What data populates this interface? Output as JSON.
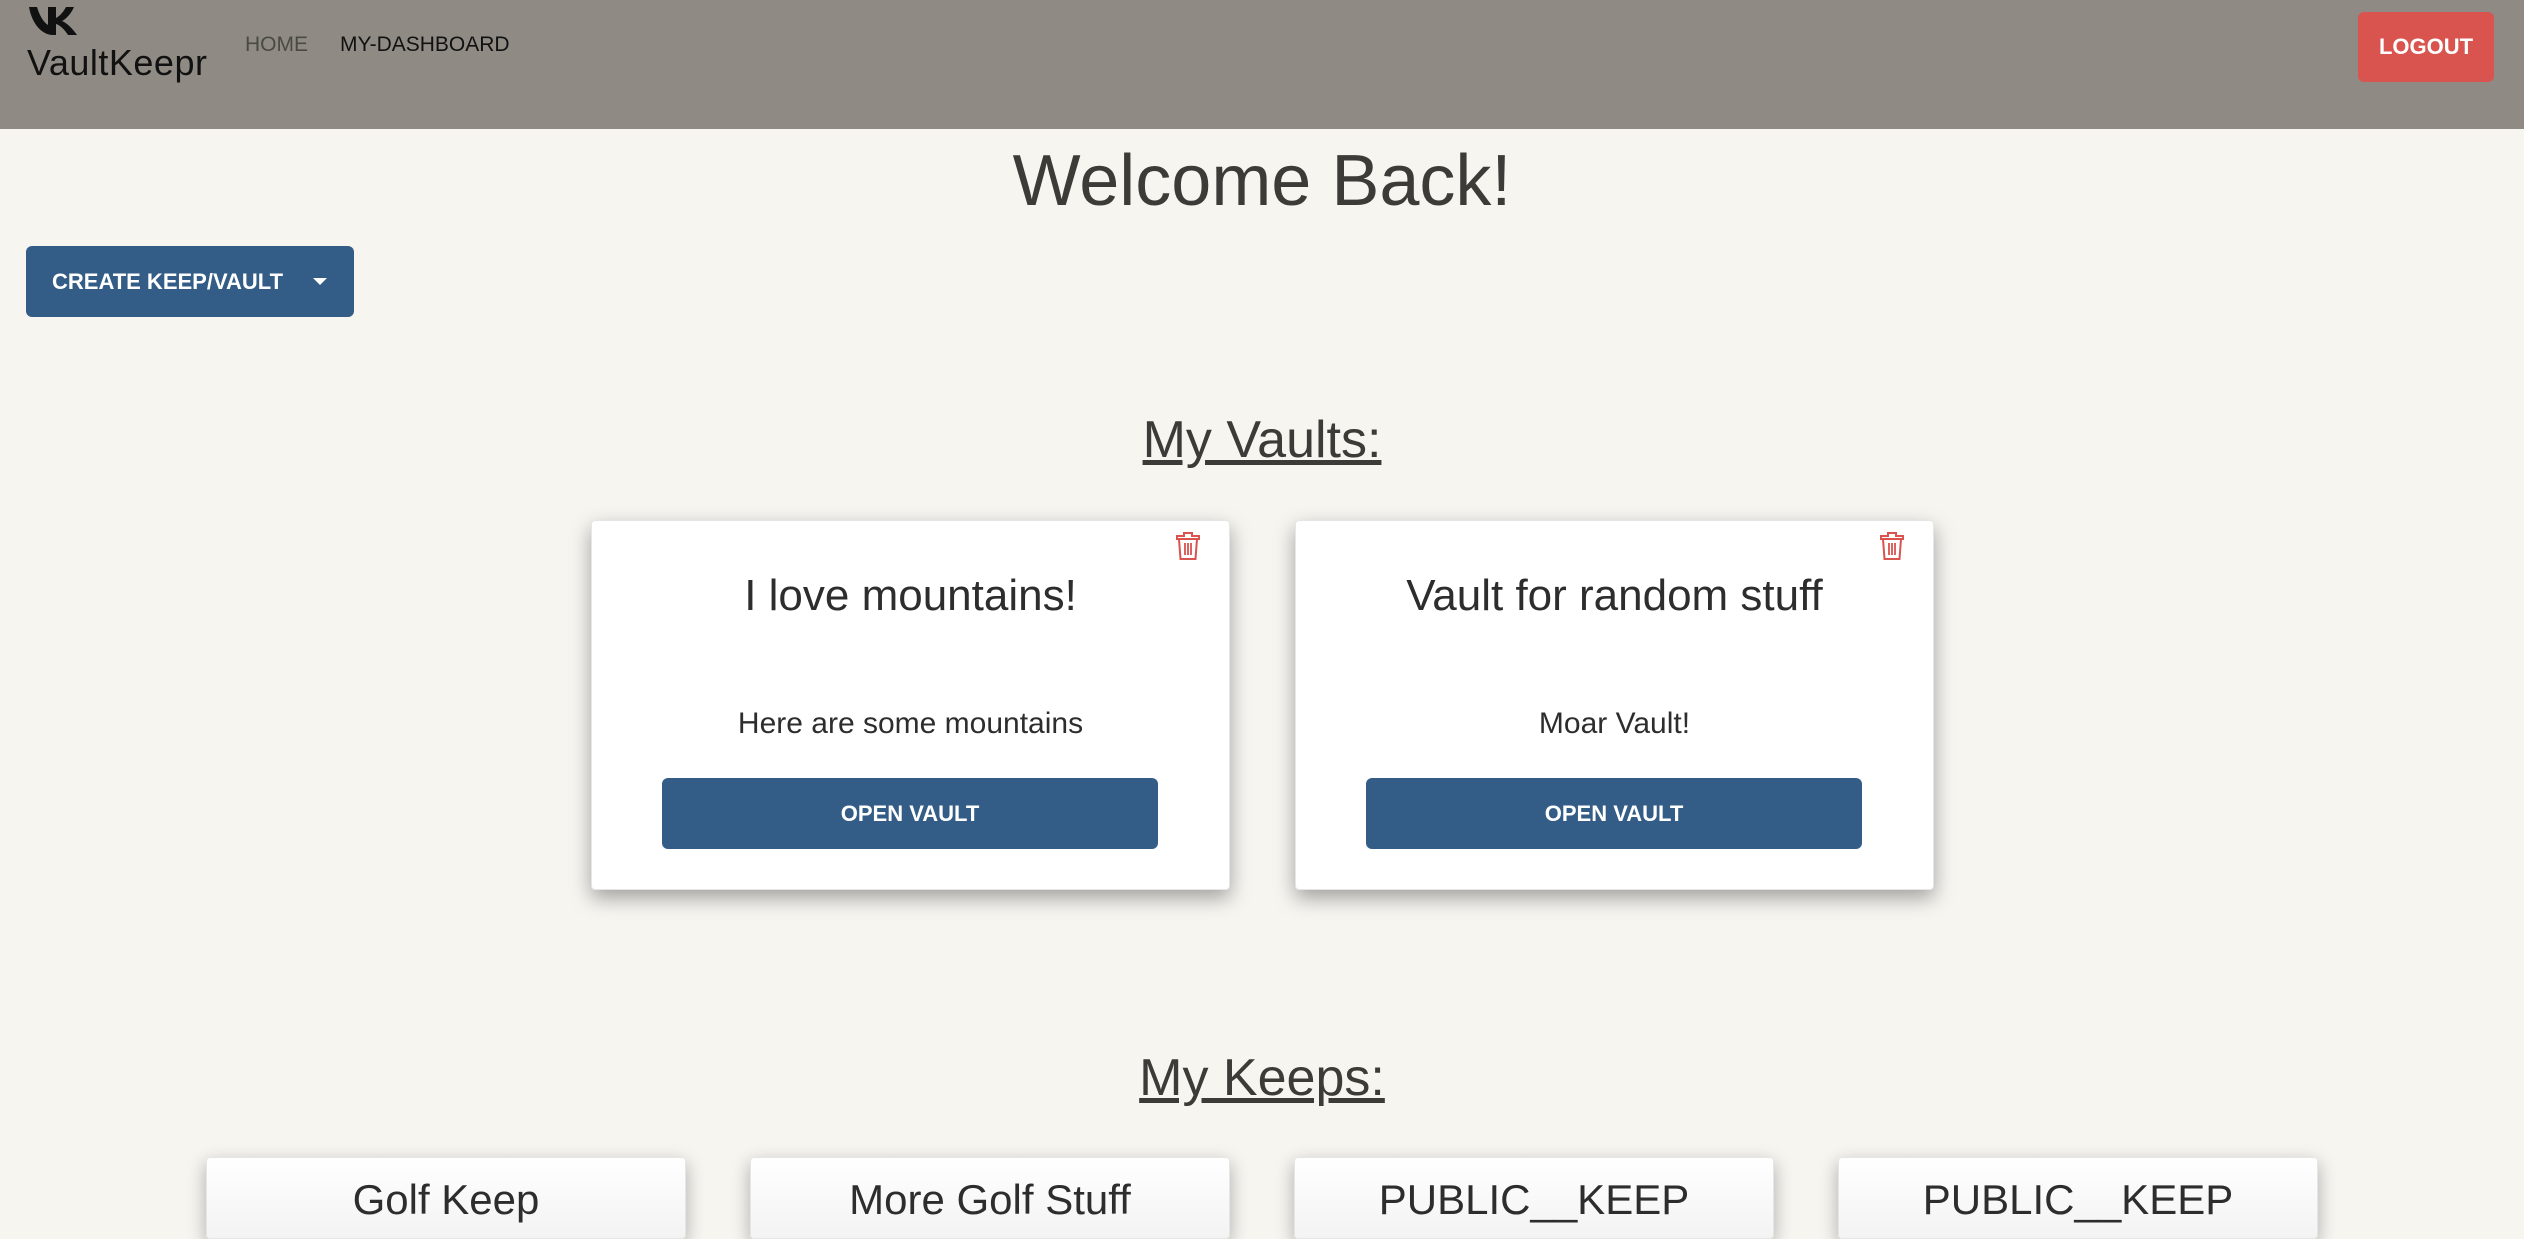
{
  "navbar": {
    "brand_name": "VaultKeepr",
    "brand_icon": "vk-logo-icon",
    "links": [
      {
        "label": "HOME"
      },
      {
        "label": "MY-DASHBOARD"
      }
    ],
    "logout_label": "LOGOUT"
  },
  "page": {
    "welcome": "Welcome Back!",
    "create_label": "CREATE KEEP/VAULT"
  },
  "vaults": {
    "title": "My Vaults:",
    "items": [
      {
        "name": "I love mountains!",
        "description": "Here are some mountains",
        "button": "OPEN VAULT"
      },
      {
        "name": "Vault for random stuff",
        "description": "Moar Vault!",
        "button": "OPEN VAULT"
      }
    ]
  },
  "keeps": {
    "title": "My Keeps:",
    "items": [
      {
        "name": "Golf Keep"
      },
      {
        "name": "More Golf Stuff"
      },
      {
        "name": "PUBLIC__KEEP"
      },
      {
        "name": "PUBLIC__KEEP"
      }
    ]
  },
  "colors": {
    "navbar": "#8f8b84",
    "primary": "#335d87",
    "danger": "#d9534f",
    "background": "#f7f5f0"
  }
}
